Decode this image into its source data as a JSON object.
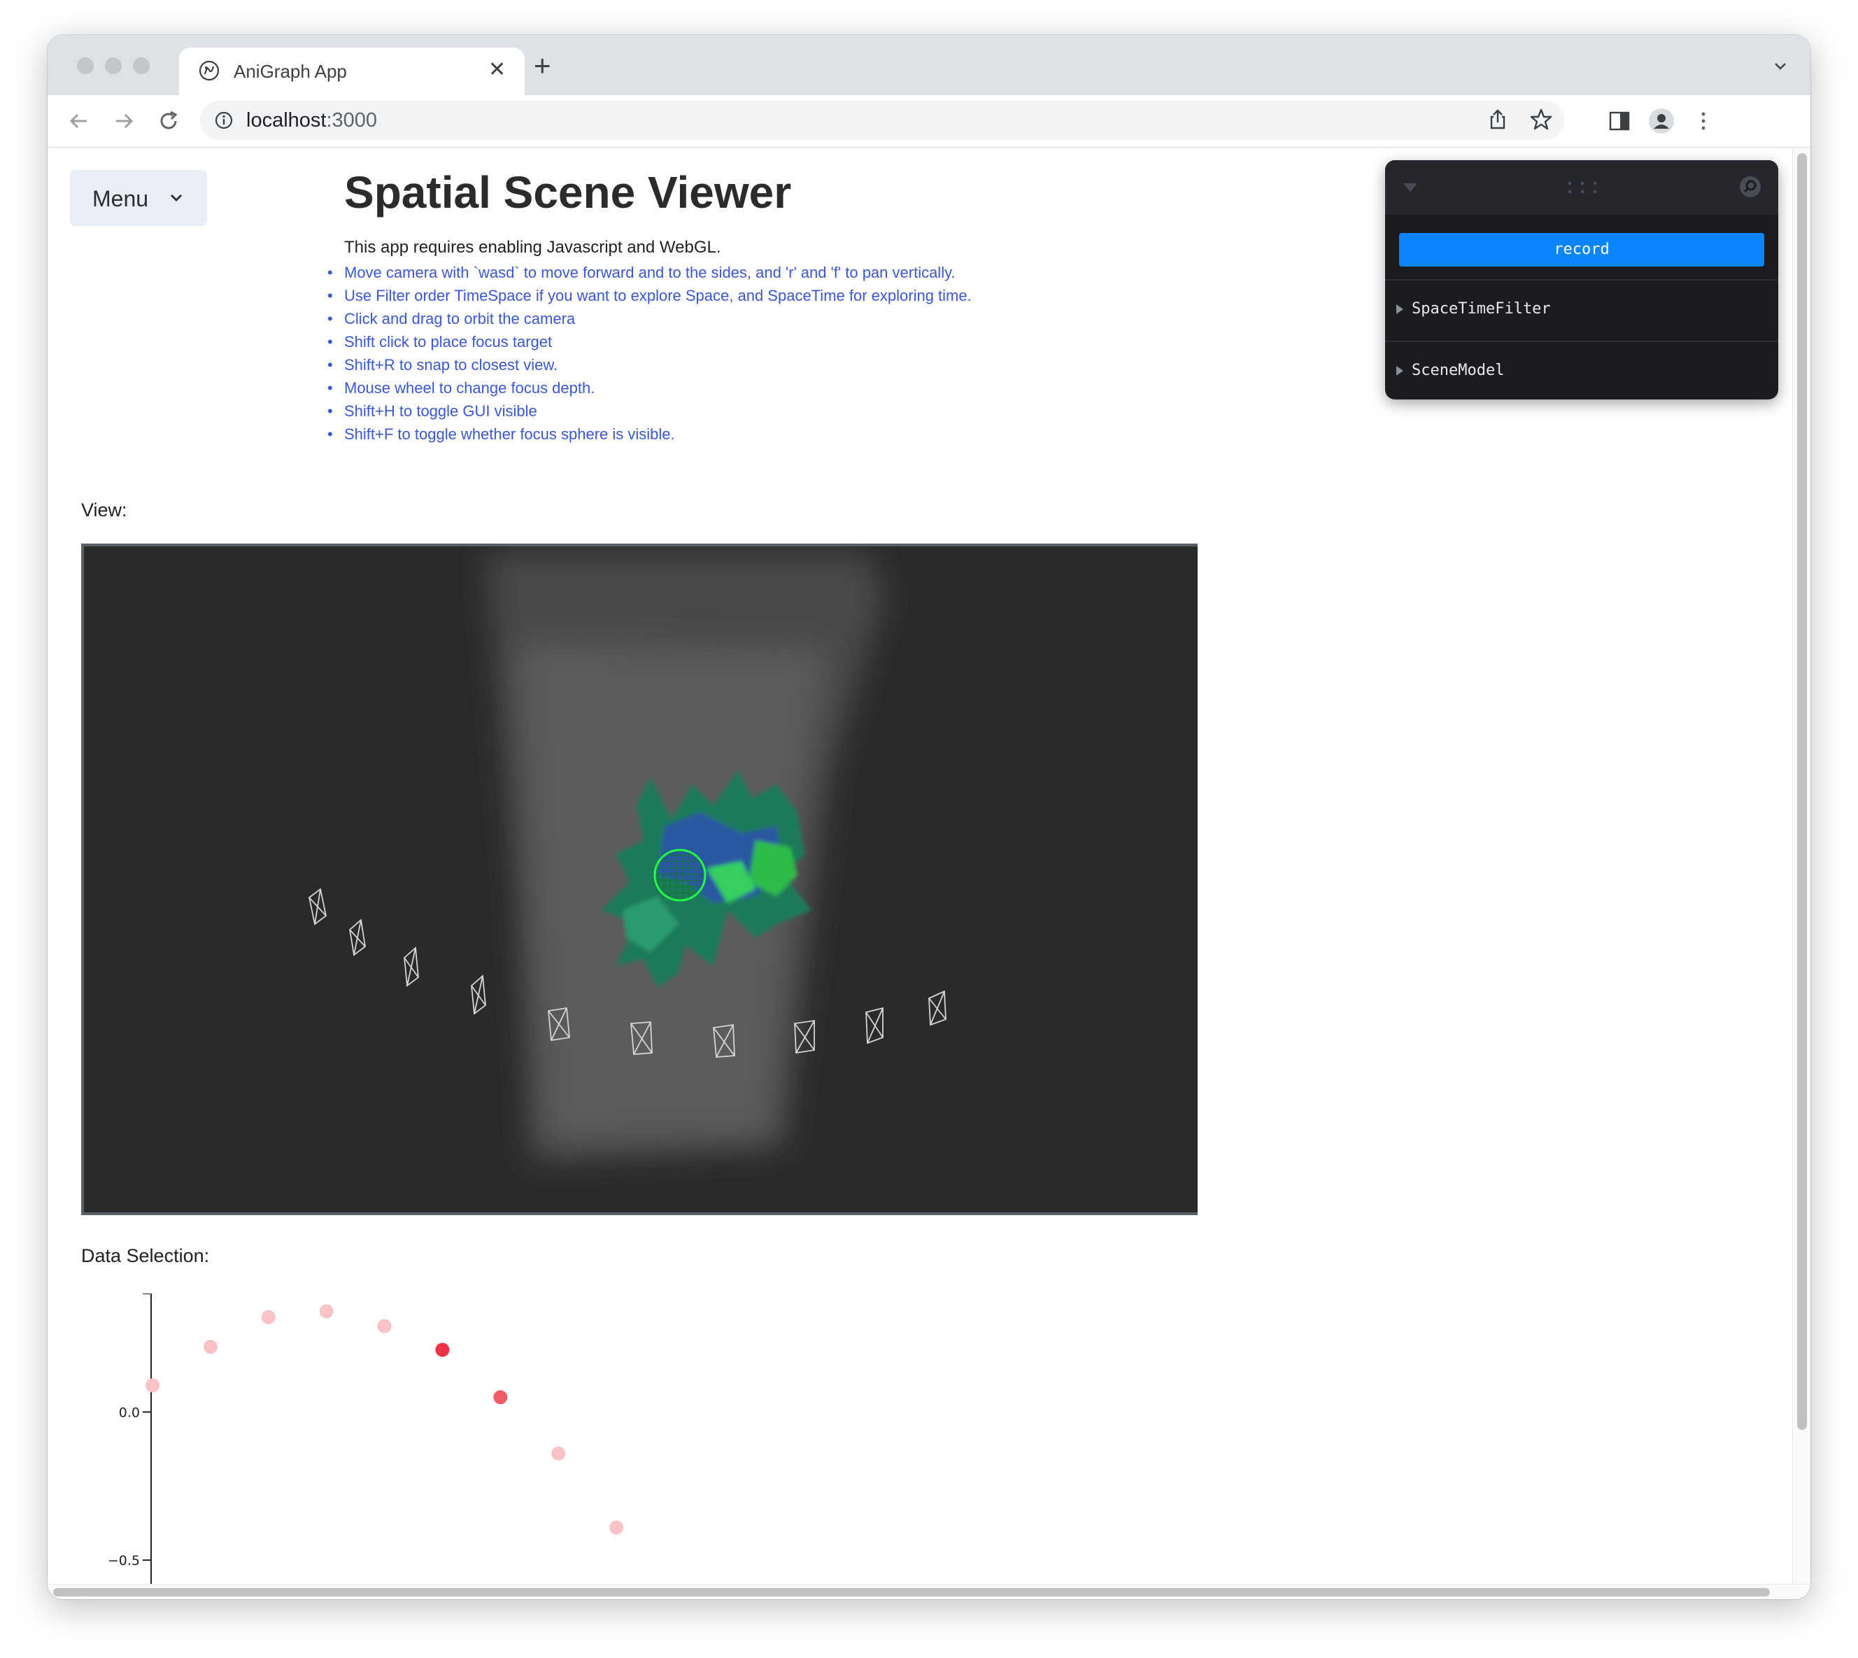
{
  "browser": {
    "tab_title": "AniGraph App",
    "new_tab_label": "+",
    "close_tab_label": "✕",
    "url_host": "localhost",
    "url_port": ":3000"
  },
  "page": {
    "menu_label": "Menu",
    "title": "Spatial Scene Viewer",
    "intro": "This app requires enabling Javascript and WebGL.",
    "instructions": [
      "Move camera with `wasd` to move forward and to the sides, and 'r' and 'f' to pan vertically.",
      "Use Filter order TimeSpace if you want to explore Space, and SpaceTime for exploring time.",
      "Click and drag to orbit the camera",
      "Shift click to place focus target",
      "Shift+R to snap to closest view.",
      "Mouse wheel to change focus depth.",
      "Shift+H to toggle GUI visible",
      "Shift+F to toggle whether focus sphere is visible."
    ],
    "view_label": "View:",
    "data_selection_label": "Data Selection:"
  },
  "gui": {
    "record_label": "record",
    "folders": [
      "SpaceTimeFilter",
      "SceneModel"
    ]
  },
  "colors": {
    "link_text": "#3a57d6",
    "record_button": "#0b84ff",
    "gui_background": "#1b1c20",
    "viewport_background": "#2a2a2a",
    "focus_sphere": "#22ff44",
    "point_selected": "#ee3344",
    "point_faded": "#f9c3c6"
  },
  "chart_data": {
    "type": "scatter",
    "y_tick_labels": [
      "0.0",
      "−0.5"
    ],
    "y_ticks": [
      0.0,
      -0.5
    ],
    "xlim": [
      0,
      8.3
    ],
    "ylim": [
      -0.58,
      0.4
    ],
    "points": [
      {
        "x": 0.0,
        "y": 0.09,
        "selected": false
      },
      {
        "x": 1.0,
        "y": 0.22,
        "selected": false
      },
      {
        "x": 2.0,
        "y": 0.32,
        "selected": false
      },
      {
        "x": 3.0,
        "y": 0.34,
        "selected": false
      },
      {
        "x": 4.0,
        "y": 0.29,
        "selected": false
      },
      {
        "x": 5.0,
        "y": 0.21,
        "selected": true,
        "strength": 1.0
      },
      {
        "x": 6.0,
        "y": 0.05,
        "selected": true,
        "strength": 0.7
      },
      {
        "x": 7.0,
        "y": -0.14,
        "selected": false
      },
      {
        "x": 8.0,
        "y": -0.39,
        "selected": false
      }
    ]
  }
}
